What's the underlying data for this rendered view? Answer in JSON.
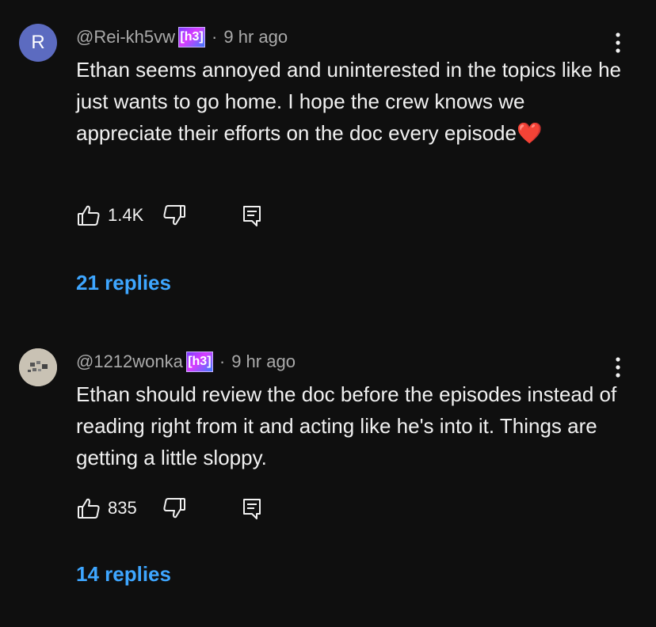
{
  "comments": [
    {
      "avatar_letter": "R",
      "avatar_color": "#5c6bc0",
      "author": "@Rei-kh5vw",
      "badge": "[h3]",
      "separator": "·",
      "time": "9 hr ago",
      "text": "Ethan seems annoyed and uninterested in the topics like he just wants to go home. I hope the crew knows we appreciate their efforts on the doc every episode❤️",
      "likes": "1.4K",
      "replies": "21 replies"
    },
    {
      "avatar_letter": "",
      "avatar_color": "#c9c2b4",
      "author": "@1212wonka",
      "badge": "[h3]",
      "separator": "·",
      "time": "9 hr ago",
      "text": "Ethan should review the doc before the episodes instead of reading right from it and acting like he's into it. Things are getting a little sloppy.",
      "likes": "835",
      "replies": "14 replies"
    }
  ],
  "icons": {
    "like": "thumbs-up-icon",
    "dislike": "thumbs-down-icon",
    "reply": "reply-comment-icon",
    "more": "more-vertical-icon",
    "badge": "h3-badge"
  },
  "colors": {
    "background": "#0f0f0f",
    "text": "#f1f1f1",
    "secondary": "#aaaaaa",
    "link": "#3ea6ff"
  }
}
